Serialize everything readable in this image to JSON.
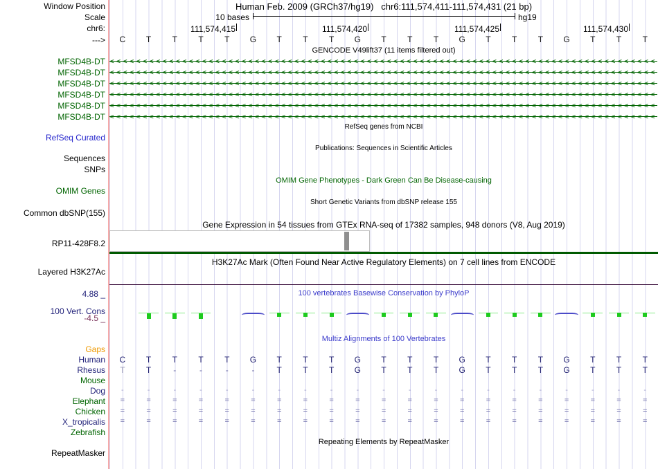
{
  "colors": {
    "dark_green": "#006400",
    "refseq_blue": "#2626cc",
    "phylop_blue": "#3c3ccb",
    "multiz_navy": "#1f1f70",
    "gaps_orange": "#ee9900",
    "min_maroon": "#7a3059",
    "grid": "#d6d6ef",
    "left_border_pink": "#f5a9a9"
  },
  "header": {
    "window_position_label": "Window Position",
    "assembly": "Human Feb. 2009 (GRCh37/hg19)",
    "position": "chr6:111,574,411-111,574,431 (21 bp)",
    "scale_label": "Scale",
    "scale_value": "10 bases",
    "assembly_short": "hg19",
    "chrom_label": "chr6:",
    "strand_label": "--->",
    "coords": [
      "111,574,415",
      "111,574,420",
      "111,574,425",
      "111,574,430"
    ]
  },
  "sequence": {
    "bases": [
      "C",
      "T",
      "T",
      "T",
      "T",
      "G",
      "T",
      "T",
      "T",
      "G",
      "T",
      "T",
      "T",
      "G",
      "T",
      "T",
      "T",
      "G",
      "T",
      "T",
      "T"
    ]
  },
  "gencode": {
    "title": "GENCODE V49lift37 (11 items filtered out)",
    "gene_label": "MFSD4B-DT",
    "genes": [
      {
        "name": "MFSD4B-DT"
      },
      {
        "name": "MFSD4B-DT"
      },
      {
        "name": "MFSD4B-DT"
      },
      {
        "name": "MFSD4B-DT"
      },
      {
        "name": "MFSD4B-DT"
      },
      {
        "name": "MFSD4B-DT"
      }
    ],
    "arrows": "<<<<<<<<<<<<<<<<<<<<<<<<<<<<<<<<<<<<<<<<<<<<<<<<<<<<<<<<<<<<<<<<<<<<<<<<<<<<<<<<<<<<<<<<"
  },
  "tracks": {
    "refseq": {
      "title": "RefSeq genes from NCBI",
      "label": "RefSeq Curated"
    },
    "publications": {
      "title": "Publications: Sequences in Scientific Articles",
      "label_sequences": "Sequences",
      "label_snps": "SNPs"
    },
    "omim": {
      "title": "OMIM Gene Phenotypes - Dark Green Can Be Disease-causing",
      "label": "OMIM Genes"
    },
    "dbsnp": {
      "title": "Short Genetic Variants from dbSNP release 155",
      "label": "Common dbSNP(155)"
    },
    "gtex": {
      "title": "Gene Expression in 54 tissues from GTEx RNA-seq of 17382 samples, 948 donors (V8, Aug 2019)",
      "label": "RP11-428F8.2"
    },
    "h3k27ac": {
      "title": "H3K27Ac Mark (Often Found Near Active Regulatory Elements) on 7 cell lines from ENCODE",
      "label": "Layered H3K27Ac"
    },
    "phylop": {
      "title": "100 vertebrates Basewise Conservation by PhyloP",
      "label": "100 Vert. Cons",
      "max": "4.88 _",
      "min": "-4.5 _",
      "marks": [
        {
          "k": "none"
        },
        {
          "k": "gbig"
        },
        {
          "k": "gbig"
        },
        {
          "k": "gbig"
        },
        {
          "k": "none"
        },
        {
          "k": "blue"
        },
        {
          "k": "gsml"
        },
        {
          "k": "gsml"
        },
        {
          "k": "gsml"
        },
        {
          "k": "blue"
        },
        {
          "k": "gsml"
        },
        {
          "k": "gsml"
        },
        {
          "k": "gsml"
        },
        {
          "k": "blue"
        },
        {
          "k": "gsml"
        },
        {
          "k": "gsml"
        },
        {
          "k": "gsml"
        },
        {
          "k": "blue"
        },
        {
          "k": "gsml"
        },
        {
          "k": "gsml"
        },
        {
          "k": "gsml"
        }
      ]
    },
    "multiz": {
      "title": "Multiz Alignments of 100 Vertebrates",
      "rows": [
        {
          "label": "Gaps",
          "cells": []
        },
        {
          "label": "Human",
          "cells": [
            "C",
            "T",
            "T",
            "T",
            "T",
            "G",
            "T",
            "T",
            "T",
            "G",
            "T",
            "T",
            "T",
            "G",
            "T",
            "T",
            "T",
            "G",
            "T",
            "T",
            "T"
          ]
        },
        {
          "label": "Rhesus",
          "cells": [
            {
              "c": "T",
              "k": "dim"
            },
            "T",
            {
              "c": "-",
              "k": "dash"
            },
            {
              "c": "-",
              "k": "dash"
            },
            {
              "c": "-",
              "k": "dash"
            },
            {
              "c": "-",
              "k": "dash"
            },
            "T",
            "T",
            "T",
            "G",
            "T",
            "T",
            "T",
            "G",
            "T",
            "T",
            "T",
            "G",
            "T",
            "T",
            "T"
          ]
        },
        {
          "label": "Mouse",
          "cells": []
        },
        {
          "label": "Dog",
          "cells": [
            "-",
            "-",
            "-",
            "-",
            "-",
            "-",
            "-",
            "-",
            "-",
            "-",
            "-",
            "-",
            "-",
            "-",
            "-",
            "-",
            "-",
            "-",
            "-",
            "-",
            "-"
          ]
        },
        {
          "label": "Elephant",
          "cells": [
            "=",
            "=",
            "=",
            "=",
            "=",
            "=",
            "=",
            "=",
            "=",
            "=",
            "=",
            "=",
            "=",
            "=",
            "=",
            "=",
            "=",
            "=",
            "=",
            "=",
            "="
          ]
        },
        {
          "label": "Chicken",
          "cells": [
            "=",
            "=",
            "=",
            "=",
            "=",
            "=",
            "=",
            "=",
            "=",
            "=",
            "=",
            "=",
            "=",
            "=",
            "=",
            "=",
            "=",
            "=",
            "=",
            "=",
            "="
          ]
        },
        {
          "label": "X_tropicalis",
          "cells": [
            "=",
            "=",
            "=",
            "=",
            "=",
            "=",
            "=",
            "=",
            "=",
            "=",
            "=",
            "=",
            "=",
            "=",
            "=",
            "=",
            "=",
            "=",
            "=",
            "=",
            "="
          ]
        },
        {
          "label": "Zebrafish",
          "cells": []
        }
      ]
    },
    "repeatmasker": {
      "title": "Repeating Elements by RepeatMasker",
      "label": "RepeatMasker"
    }
  }
}
